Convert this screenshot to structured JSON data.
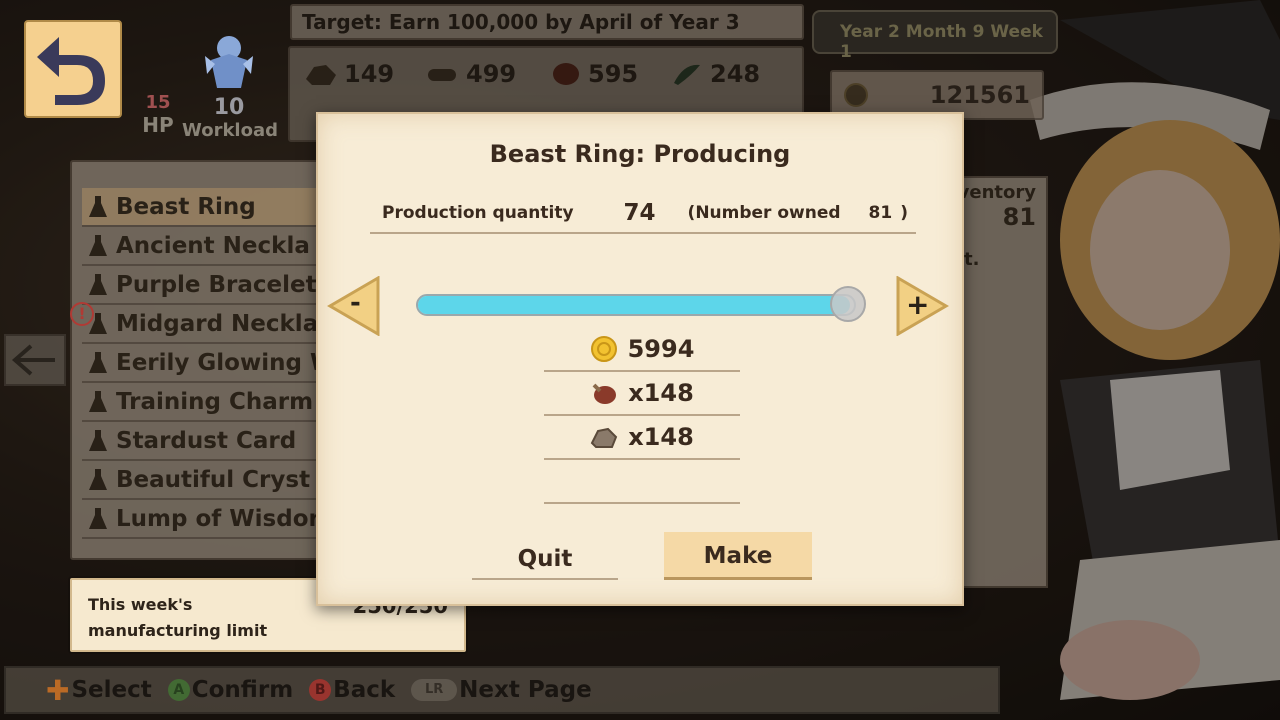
{
  "header": {
    "back_icon": "undo-arrow-icon",
    "hp": {
      "value": "15",
      "label": "HP"
    },
    "workload": {
      "value": "10",
      "label": "Workload"
    },
    "target": "Target: Earn 100,000 by April of Year 3",
    "date": "Year 2 Month 9 Week 1",
    "money": "121561",
    "resources": [
      {
        "icon": "ore-icon",
        "value": "149"
      },
      {
        "icon": "wood-log-icon",
        "value": "499"
      },
      {
        "icon": "meat-icon",
        "value": "595"
      },
      {
        "icon": "herb-icon",
        "value": "248"
      }
    ]
  },
  "item_list": {
    "items": [
      {
        "label": "Beast Ring",
        "selected": true
      },
      {
        "label": "Ancient Neckla"
      },
      {
        "label": "Purple Bracelet"
      },
      {
        "label": "Midgard Neckla",
        "alert": true
      },
      {
        "label": "Eerily Glowing W"
      },
      {
        "label": "Training Charm"
      },
      {
        "label": "Stardust Card"
      },
      {
        "label": "Beautiful Cryst"
      },
      {
        "label": "Lump of Wisdor"
      }
    ]
  },
  "inventory": {
    "label": "ventory",
    "value": "81",
    "extra": "t."
  },
  "weekly_limit": {
    "label": "This week's manufacturing limit",
    "value": "250/250"
  },
  "hints": [
    {
      "icon": "dpad-plus-icon",
      "label": "Select"
    },
    {
      "icon": "a-button-icon",
      "label": "Confirm"
    },
    {
      "icon": "b-button-icon",
      "label": "Back"
    },
    {
      "icon": "lr-button-icon",
      "label": "Next Page"
    }
  ],
  "modal": {
    "title": "Beast Ring: Producing",
    "quantity_label": "Production quantity",
    "quantity": "74",
    "owned_open": "(Number owned",
    "owned_value": "81",
    "owned_close": ")",
    "minus_label": "-",
    "plus_label": "+",
    "slider_fraction": 0.99,
    "costs": [
      {
        "icon": "gold-coin-icon",
        "value": "5994"
      },
      {
        "icon": "meat-icon",
        "value": "x148"
      },
      {
        "icon": "ore-icon",
        "value": "x148"
      },
      {
        "icon": "",
        "value": ""
      }
    ],
    "quit_label": "Quit",
    "make_label": "Make"
  },
  "colors": {
    "slider_fill": "#5dd6ea",
    "panel_bg": "#f7ecd6",
    "button_bg": "#f5d9a6",
    "back_button": "#f5d08f"
  }
}
